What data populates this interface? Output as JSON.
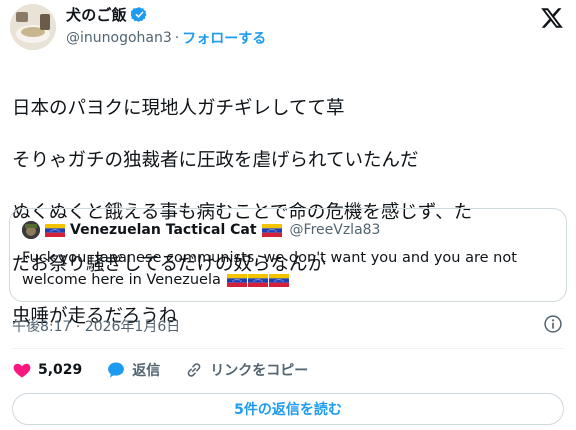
{
  "author": {
    "display_name": "犬のご飯",
    "handle": "@inunogohan3",
    "separator": "·",
    "follow_label": "フォローする"
  },
  "tweet": {
    "lines": [
      "日本のパヨクに現地人ガチギレしてて草",
      "そりゃガチの独裁者に圧政を虐げられていたんだ",
      "ぬくぬくと餓える事も病むことで命の危機を感じず、た",
      "だお祭り騒ぎしてるだけの奴らなんか",
      "虫唾が走るだろうね"
    ]
  },
  "quote": {
    "display_name": "Venezuelan Tactical Cat",
    "handle": "@FreeVzla83",
    "text": "Fuck you, Japanese communists, we don't want you and you are not welcome here in Venezuela"
  },
  "meta": {
    "timestamp": "午後8:17 · 2026年1月6日"
  },
  "actions": {
    "like_count": "5,029",
    "reply_label": "返信",
    "copy_link_label": "リンクをコピー"
  },
  "read_replies_label": "5件の返信を読む",
  "colors": {
    "accent": "#1d9bf0",
    "like": "#f91880",
    "text_secondary": "#536471",
    "border": "#cfd9de"
  },
  "icons": {
    "verified": "verified-badge-icon",
    "x_logo": "x-logo-icon",
    "info": "info-icon",
    "like": "heart-icon",
    "reply": "speech-bubble-icon",
    "copy_link": "link-icon",
    "flag": "venezuela-flag-icon"
  }
}
